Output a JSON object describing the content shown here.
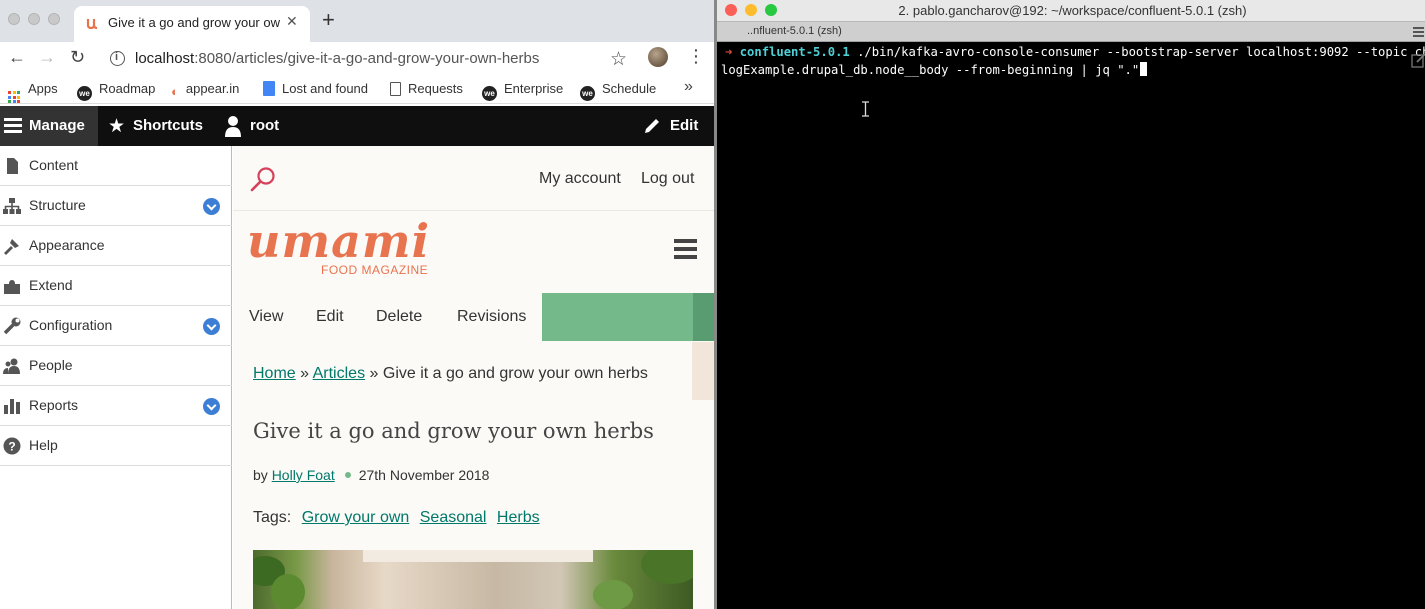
{
  "browser": {
    "tab": {
      "title": "Give it a go and grow your own herbs"
    },
    "url": {
      "host": "localhost",
      "rest": ":8080/articles/give-it-a-go-and-grow-your-own-herbs"
    },
    "bookmarks": [
      "Apps",
      "Roadmap",
      "appear.in",
      "Lost and found",
      "Requests",
      "Enterprise",
      "Schedule"
    ],
    "more": "»"
  },
  "drupal": {
    "toolbar": {
      "manage": "Manage",
      "shortcuts": "Shortcuts",
      "user": "root",
      "edit": "Edit"
    },
    "menu": [
      {
        "label": "Content",
        "icon": "content-icon",
        "expandable": false
      },
      {
        "label": "Structure",
        "icon": "structure-icon",
        "expandable": true
      },
      {
        "label": "Appearance",
        "icon": "appearance-icon",
        "expandable": false
      },
      {
        "label": "Extend",
        "icon": "extend-icon",
        "expandable": false
      },
      {
        "label": "Configuration",
        "icon": "configuration-icon",
        "expandable": true
      },
      {
        "label": "People",
        "icon": "people-icon",
        "expandable": false
      },
      {
        "label": "Reports",
        "icon": "reports-icon",
        "expandable": true
      },
      {
        "label": "Help",
        "icon": "help-icon",
        "expandable": false
      }
    ]
  },
  "site": {
    "links": {
      "account": "My account",
      "logout": "Log out"
    },
    "logo": {
      "word": "umami",
      "sub": "FOOD MAGAZINE"
    },
    "local_tabs": [
      "View",
      "Edit",
      "Delete",
      "Revisions"
    ],
    "breadcrumb": {
      "home": "Home",
      "sep": "»",
      "articles": "Articles",
      "current": "Give it a go and grow your own herbs"
    },
    "article": {
      "title": "Give it a go and grow your own herbs",
      "by": "by",
      "author": "Holly Foat",
      "date": "27th November 2018",
      "tags_label": "Tags:",
      "tags": [
        "Grow your own",
        "Seasonal",
        "Herbs"
      ]
    },
    "colors": {
      "accent": "#e8734f",
      "link": "#00786a",
      "green": "#74b98a"
    }
  },
  "terminal": {
    "window_title": "2. pablo.gancharov@192: ~/workspace/confluent-5.0.1 (zsh)",
    "tab_title": "..nfluent-5.0.1 (zsh)",
    "prompt_arrow": "➜",
    "prompt_dir": "confluent-5.0.1",
    "command_line1": "./bin/kafka-avro-console-consumer --bootstrap-server localhost:9092 --topic chan",
    "command_line2": "logExample.drupal_db.node__body --from-beginning | jq \".\""
  }
}
